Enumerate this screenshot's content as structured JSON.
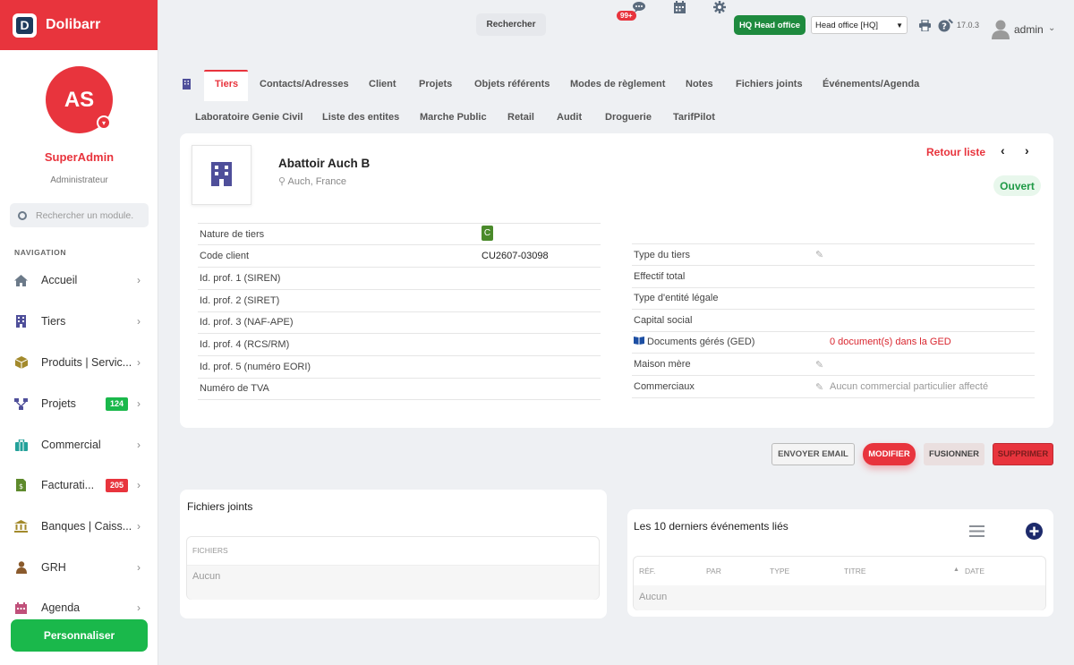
{
  "brand": {
    "name": "Dolibarr",
    "logo_letter": "D"
  },
  "user": {
    "initials": "AS",
    "name": "SuperAdmin",
    "role": "Administrateur"
  },
  "sidebar": {
    "search_placeholder": "Rechercher un module.",
    "nav_title": "NAVIGATION",
    "items": [
      {
        "label": "Accueil",
        "icon": "home-icon"
      },
      {
        "label": "Tiers",
        "icon": "building-icon"
      },
      {
        "label": "Produits | Servic...",
        "icon": "box-icon"
      },
      {
        "label": "Projets",
        "icon": "project-icon",
        "badge": "124",
        "badge_color": "#1ab84b"
      },
      {
        "label": "Commercial",
        "icon": "briefcase-icon"
      },
      {
        "label": "Facturati...",
        "icon": "invoice-icon",
        "badge": "205",
        "badge_color": "#e8343d"
      },
      {
        "label": "Banques | Caiss...",
        "icon": "bank-icon"
      },
      {
        "label": "GRH",
        "icon": "person-icon"
      },
      {
        "label": "Agenda",
        "icon": "calendar-icon"
      }
    ],
    "customize_label": "Personnaliser"
  },
  "topbar": {
    "search_label": "Rechercher",
    "notif_count": "99+",
    "hq_label": "HQ Head office",
    "entity_value": "Head office [HQ]",
    "version": "17.0.3",
    "admin_label": "admin"
  },
  "tabs_row1": [
    "Tiers",
    "Contacts/Adresses",
    "Client",
    "Projets",
    "Objets référents",
    "Modes de règlement",
    "Notes",
    "Fichiers joints",
    "Événements/Agenda"
  ],
  "tabs_row2": [
    "Laboratoire Genie Civil",
    "Liste des entites",
    "Marche Public",
    "Retail",
    "Audit",
    "Droguerie",
    "TarifPilot"
  ],
  "company": {
    "name": "Abattoir Auch B",
    "location": "Auch, France",
    "back_label": "Retour liste",
    "status": "Ouvert"
  },
  "fields_left": [
    {
      "label": "Nature de tiers",
      "value": "C"
    },
    {
      "label": "Code client",
      "value": "CU2607-03098"
    },
    {
      "label": "Id. prof. 1 (SIREN)",
      "value": ""
    },
    {
      "label": "Id. prof. 2 (SIRET)",
      "value": ""
    },
    {
      "label": "Id. prof. 3 (NAF-APE)",
      "value": ""
    },
    {
      "label": "Id. prof. 4 (RCS/RM)",
      "value": ""
    },
    {
      "label": "Id. prof. 5 (numéro EORI)",
      "value": ""
    },
    {
      "label": "Numéro de TVA",
      "value": ""
    }
  ],
  "fields_right": [
    {
      "label": "Type du tiers",
      "value": ""
    },
    {
      "label": "Effectif total",
      "value": ""
    },
    {
      "label": "Type d'entité légale",
      "value": ""
    },
    {
      "label": "Capital social",
      "value": ""
    },
    {
      "label": "Documents gérés (GED)",
      "value": "0 document(s) dans la GED"
    },
    {
      "label": "Maison mère",
      "value": ""
    },
    {
      "label": "Commerciaux",
      "value": "Aucun commercial particulier affecté"
    }
  ],
  "actions": {
    "email": "ENVOYER EMAIL",
    "modify": "MODIFIER",
    "merge": "FUSIONNER",
    "delete": "SUPPRIMER"
  },
  "files_panel": {
    "title": "Fichiers joints",
    "header": "FICHIERS",
    "empty": "Aucun"
  },
  "events_panel": {
    "title": "Les 10 derniers événements liés",
    "headers": [
      "RÉF.",
      "PAR",
      "TYPE",
      "TITRE",
      "DATE"
    ],
    "empty": "Aucun"
  }
}
